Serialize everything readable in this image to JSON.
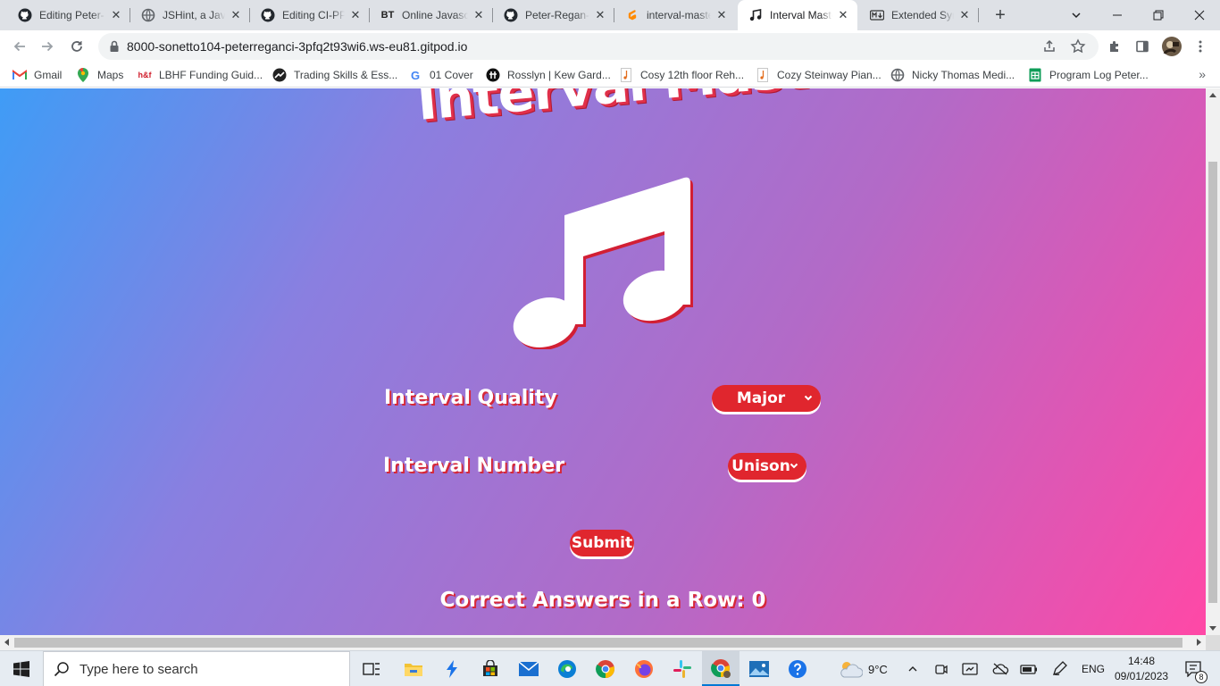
{
  "browser": {
    "tabs": [
      {
        "label": "Editing Peter-",
        "icon": "github-icon",
        "active": false
      },
      {
        "label": "JSHint, a JavaS",
        "icon": "globe-icon",
        "active": false
      },
      {
        "label": "Editing CI-PP",
        "icon": "github-icon",
        "active": false
      },
      {
        "label": "Online Javasc",
        "icon": "bt-icon",
        "active": false
      },
      {
        "label": "Peter-Regan-",
        "icon": "github-icon",
        "active": false
      },
      {
        "label": "interval-maste",
        "icon": "gitpod-icon",
        "active": false
      },
      {
        "label": "Interval Maste",
        "icon": "music-note-icon",
        "active": true
      },
      {
        "label": "Extended Syn",
        "icon": "markdown-icon",
        "active": false
      }
    ],
    "tab_close_glyph": "✕",
    "new_tab_glyph": "+",
    "url": "8000-sonetto104-peterreganci-3pfq2t93wi6.ws-eu81.gitpod.io",
    "bookmarks": [
      {
        "label": "Gmail",
        "icon": "gmail-icon"
      },
      {
        "label": "Maps",
        "icon": "maps-icon"
      },
      {
        "label": "LBHF Funding Guid...",
        "icon": "hf-icon"
      },
      {
        "label": "Trading Skills & Ess...",
        "icon": "trading-icon"
      },
      {
        "label": "01 Cover",
        "icon": "google-icon"
      },
      {
        "label": "Rosslyn | Kew Gard...",
        "icon": "rosslyn-icon"
      },
      {
        "label": "Cosy 12th floor Reh...",
        "icon": "music-note-icon"
      },
      {
        "label": "Cozy Steinway Pian...",
        "icon": "music-note-icon"
      },
      {
        "label": "Nicky Thomas Medi...",
        "icon": "globe-icon"
      },
      {
        "label": "Program Log Peter...",
        "icon": "sheets-icon"
      }
    ],
    "bookmarks_more_glyph": "»"
  },
  "page": {
    "title": "Interval Master",
    "quality_label": "Interval Quality",
    "quality_selected": "Major",
    "number_label": "Interval Number",
    "number_selected": "Unison",
    "submit_label": "Submit",
    "score_label": "Correct Answers in a Row: 0",
    "colors": {
      "gradient_start": "#3f9cf6",
      "gradient_end": "#ff48a6",
      "accent_red": "#e0262e"
    }
  },
  "taskbar": {
    "search_placeholder": "Type here to search",
    "weather": "9°C",
    "language": "ENG",
    "time": "14:48",
    "date": "09/01/2023",
    "notification_count": "8"
  }
}
